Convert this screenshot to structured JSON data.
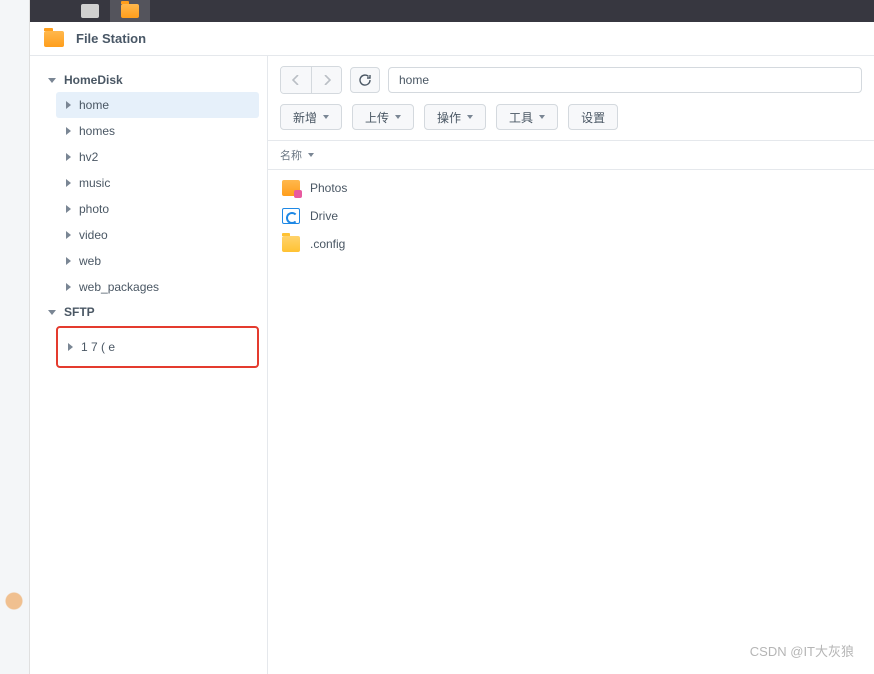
{
  "app": {
    "title": "File Station"
  },
  "sidebar": {
    "roots": [
      {
        "label": "HomeDisk",
        "children": [
          {
            "label": "home",
            "selected": true
          },
          {
            "label": "homes"
          },
          {
            "label": "hv2"
          },
          {
            "label": "music"
          },
          {
            "label": "photo"
          },
          {
            "label": "video"
          },
          {
            "label": "web"
          },
          {
            "label": "web_packages"
          }
        ]
      },
      {
        "label": "SFTP",
        "children": [
          {
            "label": "1                  7  (         e",
            "highlighted": true
          }
        ]
      }
    ]
  },
  "nav": {
    "path": "home"
  },
  "toolbar": {
    "create": "新增",
    "upload": "上传",
    "action": "操作",
    "tools": "工具",
    "settings": "设置"
  },
  "columns": {
    "name": "名称"
  },
  "files": [
    {
      "name": "Photos",
      "icon": "photos"
    },
    {
      "name": "Drive",
      "icon": "drive"
    },
    {
      "name": ".config",
      "icon": "folder"
    }
  ],
  "watermark": "CSDN @IT大灰狼"
}
